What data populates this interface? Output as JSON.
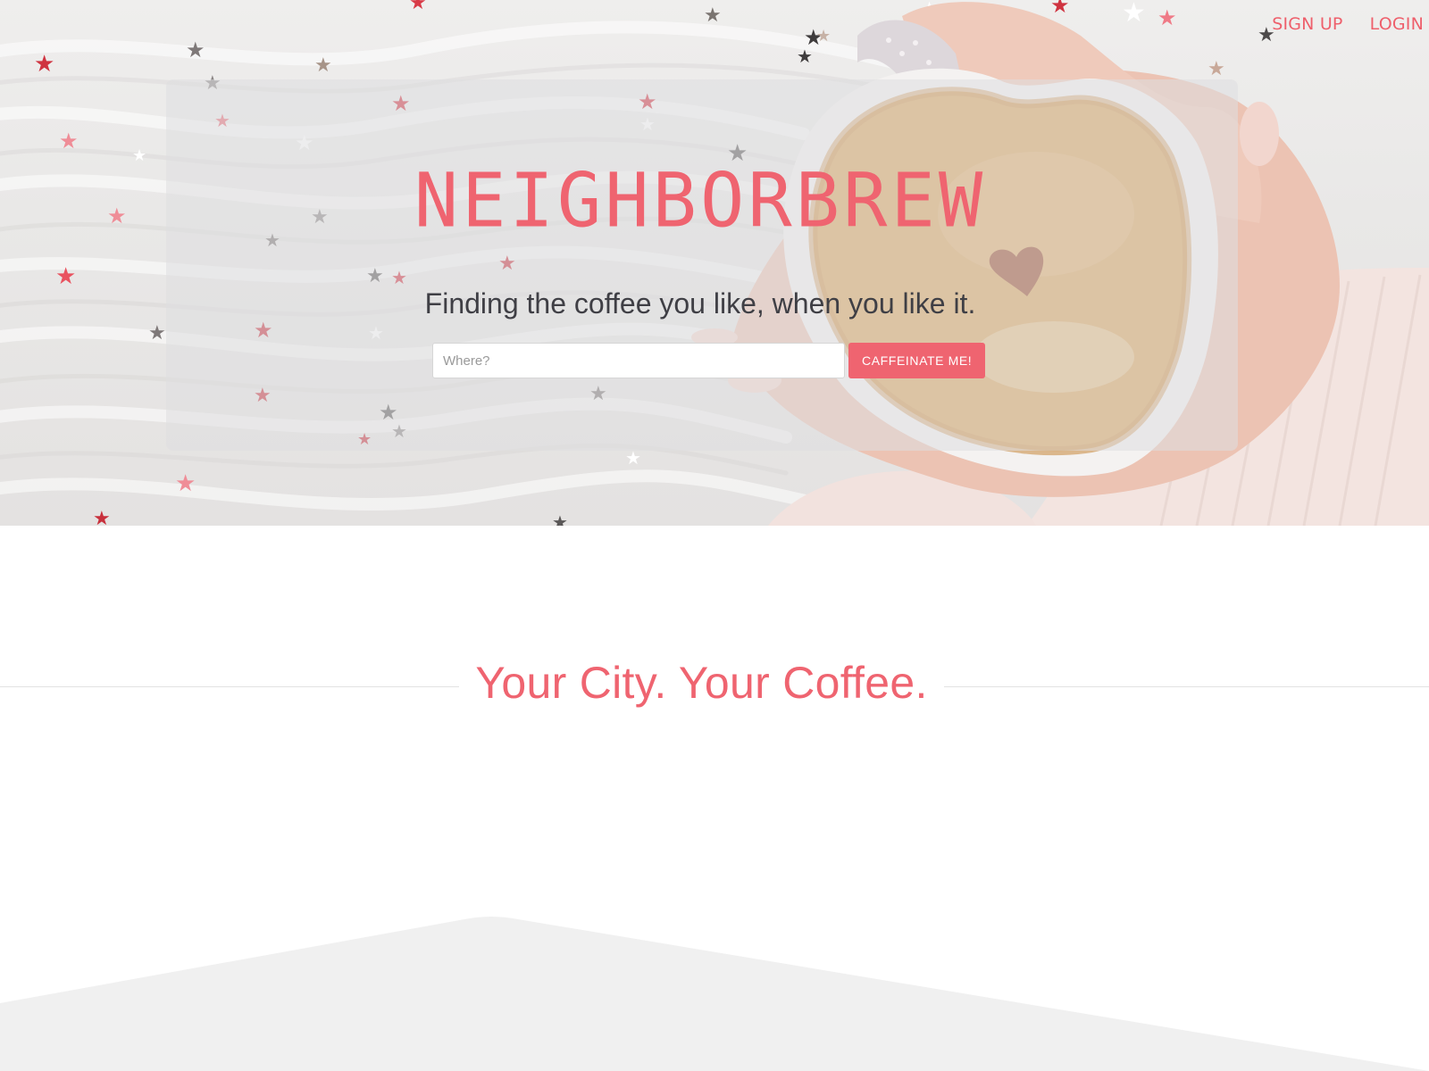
{
  "nav": {
    "signup_label": "SIGN UP",
    "login_label": "LOGIN"
  },
  "hero": {
    "brand": "NEIGHBORBREW",
    "tagline": "Finding the coffee you like, when you like it.",
    "search": {
      "placeholder": "Where?",
      "value": ""
    },
    "cta_label": "CAFFEINATE ME!"
  },
  "section": {
    "title": "Your City. Your Coffee."
  },
  "colors": {
    "accent": "#ef6470",
    "text_dark": "#3f3f45",
    "panel": "#dedee0",
    "bottom_shape": "#f0f0f0"
  }
}
